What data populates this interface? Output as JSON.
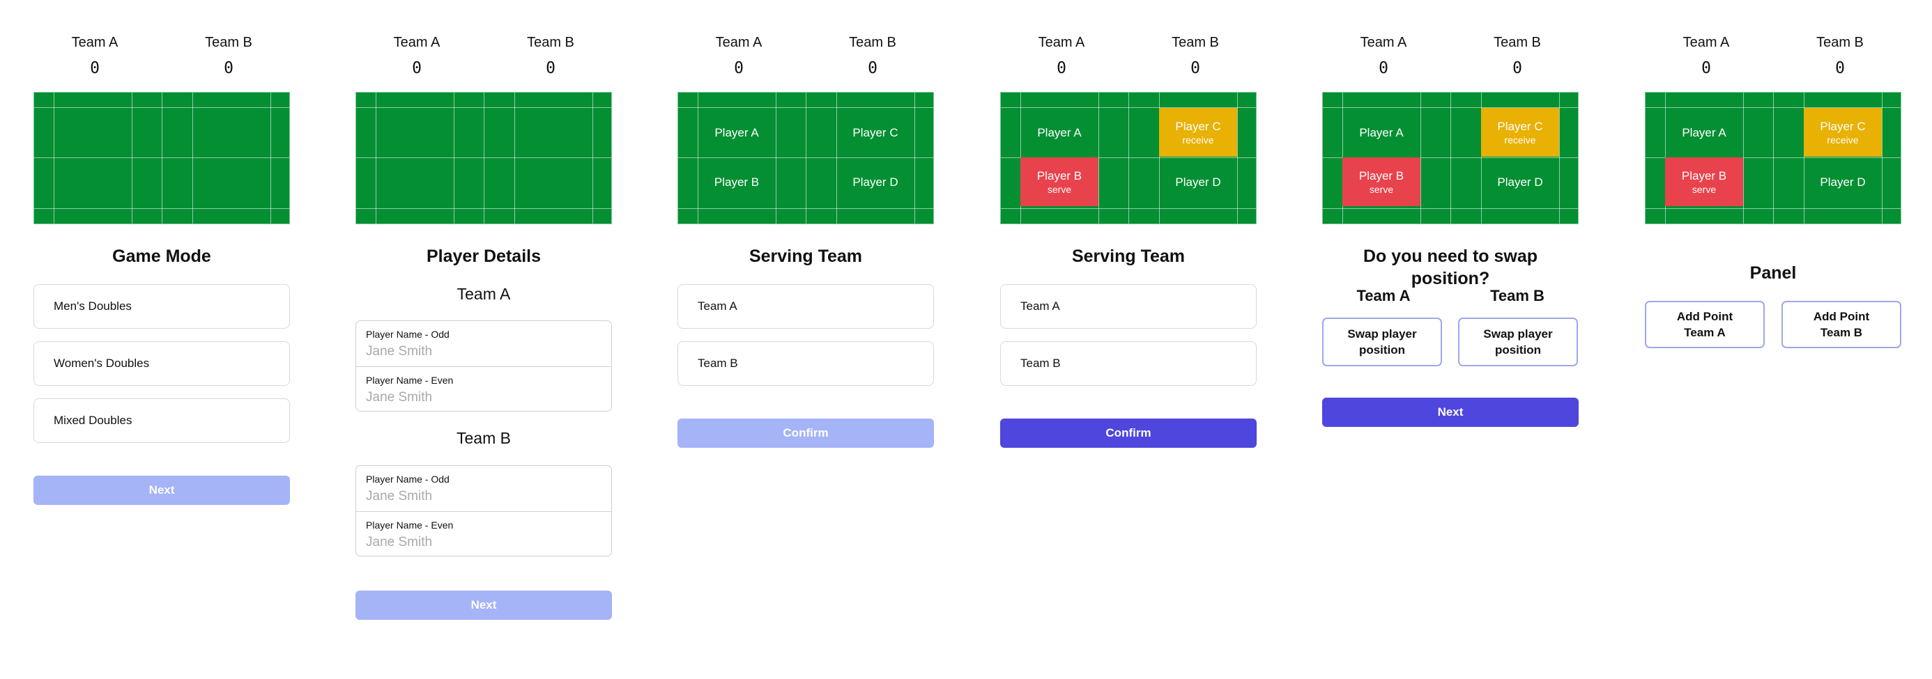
{
  "teams": {
    "a": {
      "name": "Team A",
      "score": "0"
    },
    "b": {
      "name": "Team B",
      "score": "0"
    }
  },
  "colors": {
    "court": "#058f33",
    "serve": "#e8424c",
    "receive": "#e8b103",
    "primary": "#4e46dd",
    "primary_disabled": "#a5b3f7"
  },
  "players": {
    "a": "Player A",
    "b": "Player B",
    "c": "Player C",
    "d": "Player D"
  },
  "roles": {
    "serve": "serve",
    "receive": "receive"
  },
  "screens": {
    "game_mode": {
      "heading": "Game Mode",
      "options": [
        "Men's Doubles",
        "Women's Doubles",
        "Mixed Doubles"
      ],
      "next_label": "Next"
    },
    "player_details": {
      "heading": "Player Details",
      "odd_label": "Player Name - Odd",
      "even_label": "Player Name - Even",
      "placeholder": "Jane Smith",
      "next_label": "Next"
    },
    "serving_team": {
      "heading": "Serving Team",
      "options": [
        "Team A",
        "Team B"
      ],
      "confirm_label": "Confirm"
    },
    "swap_position": {
      "heading": "Do you need to swap position?",
      "swap_label": "Swap player position",
      "next_label": "Next"
    },
    "panel": {
      "heading": "Panel",
      "add_point_label": "Add Point",
      "add_point_a_team": "Team A",
      "add_point_b_team": "Team B"
    }
  }
}
